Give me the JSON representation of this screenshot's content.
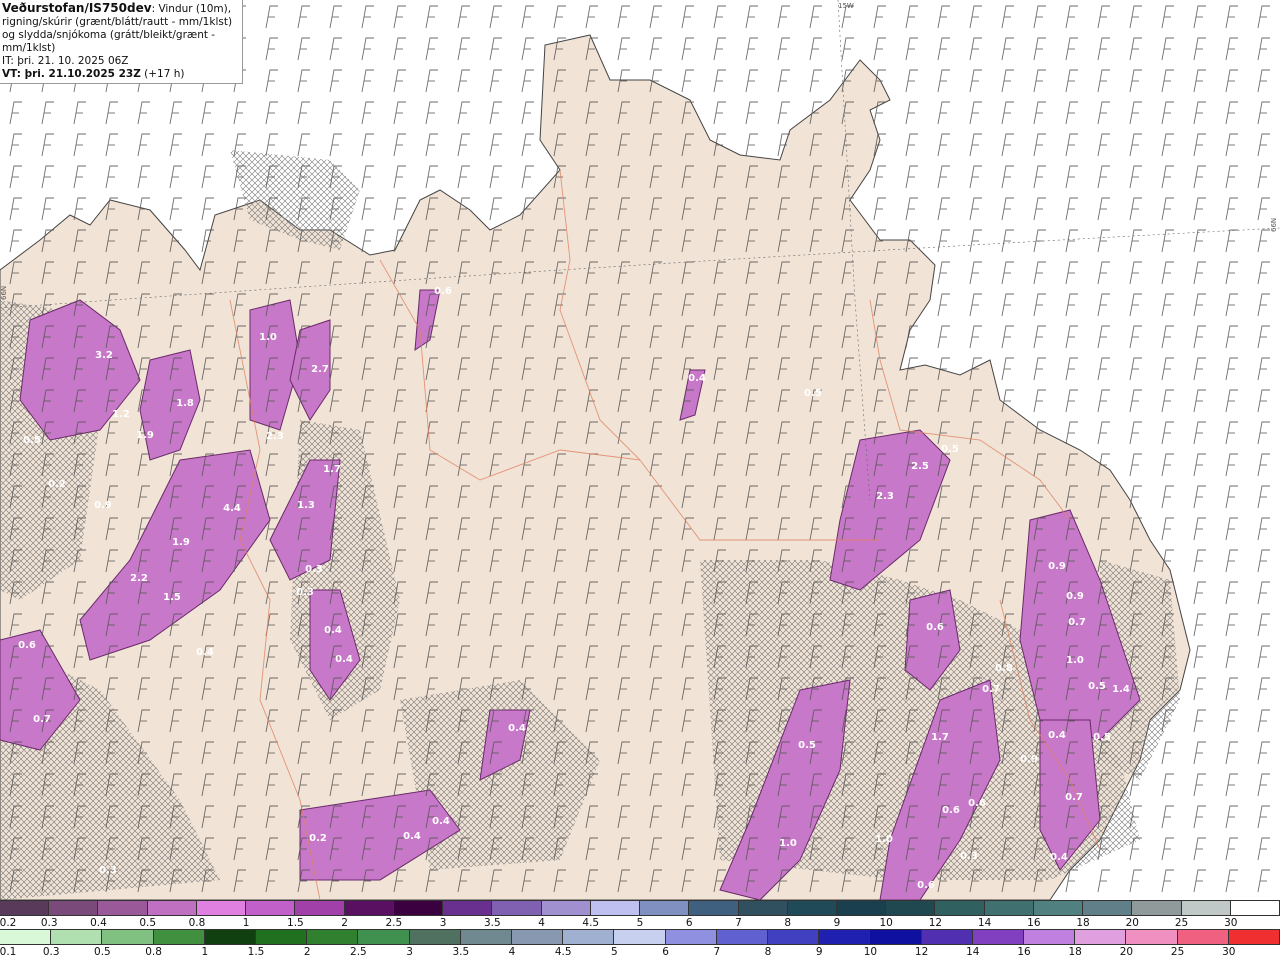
{
  "info": {
    "source": "Veðurstofan/IS750dev",
    "desc": ": Vindur (10m), rigning/skúrir (grænt/blátt/rautt - mm/1klst) og slydda/snjókoma (grátt/bleikt/grænt - mm/1klst)",
    "it": "IT: þri. 21. 10. 2025 06Z",
    "vt": "VT: þri. 21.10.2025 23Z",
    "vt_offset": " (+17 h)"
  },
  "grid_labels": {
    "lon": "15W",
    "lat_left": "66N",
    "lat_right": "66N"
  },
  "precip_labels": [
    "3.2",
    "1.2",
    "1.8",
    "0.5",
    "1.9",
    "0.2",
    "0.9",
    "1.0",
    "2.7",
    "2.3",
    "4.4",
    "1.9",
    "2.2",
    "1.5",
    "1.7",
    "1.3",
    "0.3",
    "0.3",
    "0.4",
    "0.4",
    "0.4",
    "0.6",
    "0.7",
    "0.6",
    "0.4",
    "0.5",
    "0.4",
    "0.2",
    "0.4",
    "0.4",
    "0.3",
    "2.3",
    "2.5",
    "0.6",
    "0.9",
    "0.9",
    "0.7",
    "1.0",
    "1.4",
    "0.8",
    "0.7",
    "0.5",
    "0.4",
    "0.9",
    "0.7",
    "1.7",
    "0.6",
    "0.6",
    "1.0",
    "1.0",
    "0.3",
    "0.6",
    "0.4",
    "0.5",
    "0.5",
    "0.5"
  ],
  "scale_snow": {
    "labels": [
      "0.2",
      "0.3",
      "0.4",
      "0.5",
      "0.8",
      "1",
      "1.5",
      "2",
      "2.5",
      "3",
      "3.5",
      "4",
      "4.5",
      "5",
      "6",
      "7",
      "8",
      "9",
      "10",
      "12",
      "14",
      "16",
      "18",
      "20",
      "25",
      "30"
    ],
    "colors": [
      "#5a3a5a",
      "#7a4a7a",
      "#9a5a9a",
      "#c070c0",
      "#e080e0",
      "#c060c8",
      "#a040a8",
      "#5a1060",
      "#3a0040",
      "#6a3090",
      "#8060b0",
      "#a090d0",
      "#c0c0f0",
      "#8090c0",
      "#406080",
      "#305060",
      "#204a58",
      "#1a4050",
      "#204850",
      "#306060",
      "#407070",
      "#508080",
      "#607f88",
      "#909a9a",
      "#c0c8c8",
      "#ffffff"
    ]
  },
  "scale_rain": {
    "labels": [
      "0.1",
      "0.3",
      "0.5",
      "0.8",
      "1",
      "1.5",
      "2",
      "2.5",
      "3",
      "3.5",
      "4",
      "4.5",
      "5",
      "6",
      "7",
      "8",
      "9",
      "10",
      "12",
      "14",
      "16",
      "18",
      "20",
      "25",
      "30"
    ],
    "colors": [
      "#d8f8d8",
      "#b0e0b0",
      "#80c080",
      "#409040",
      "#104010",
      "#207020",
      "#308030",
      "#409050",
      "#507060",
      "#708890",
      "#8898b0",
      "#a0b0d0",
      "#c8d0f0",
      "#9090e0",
      "#6060d0",
      "#4040c0",
      "#2020b0",
      "#1010a0",
      "#5030b0",
      "#8040c0",
      "#c080e0",
      "#e0a0e0",
      "#f090c0",
      "#f06080",
      "#f03030"
    ]
  }
}
